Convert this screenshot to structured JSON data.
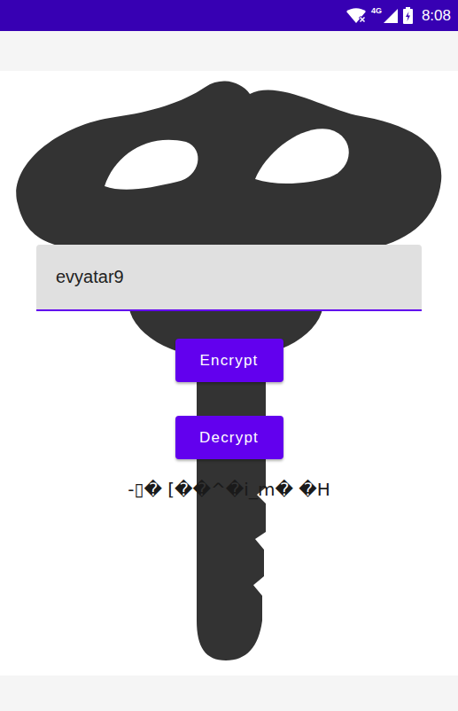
{
  "status_bar": {
    "network": "4G",
    "time": "8:08"
  },
  "input": {
    "value": "evyatar9"
  },
  "buttons": [
    {
      "label": "Encrypt"
    },
    {
      "label": "Decrypt"
    }
  ],
  "output": {
    "text": "-▯� [��^�i_m� �H"
  }
}
